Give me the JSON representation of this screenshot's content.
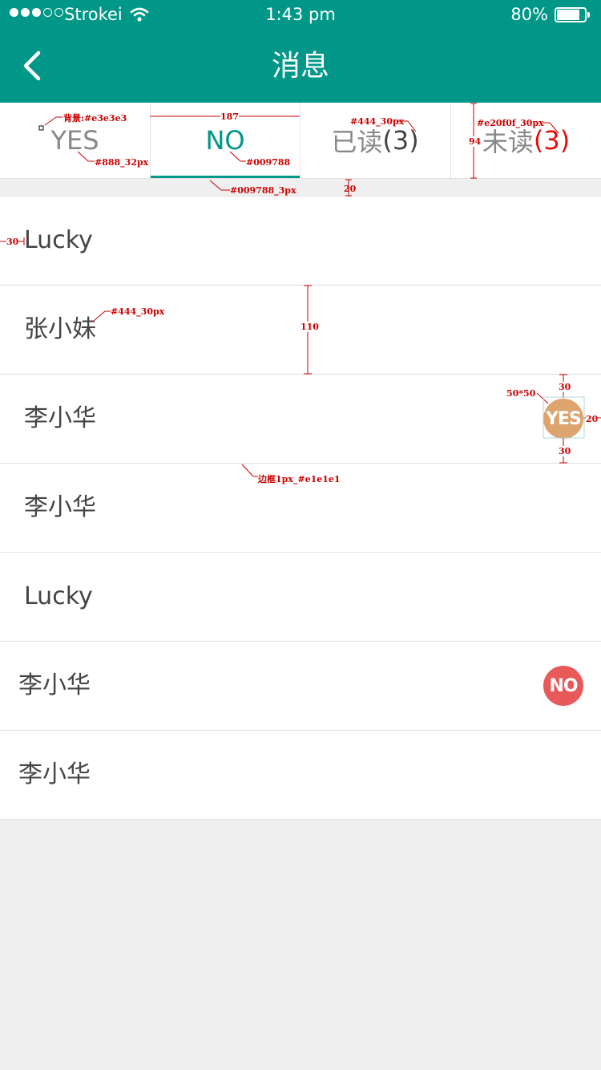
{
  "status_bar": {
    "carrier": "Strokei",
    "time": "1:43 pm",
    "battery": "80%"
  },
  "nav": {
    "title": "消息",
    "back_icon": "chevron-left-icon"
  },
  "tabs": [
    {
      "label": "YES",
      "count": ""
    },
    {
      "label": "NO",
      "count": ""
    },
    {
      "label": "已读",
      "count": "(3)"
    },
    {
      "label": "未读",
      "count": "(3)"
    }
  ],
  "rows": [
    {
      "name": "Lucky",
      "badge": ""
    },
    {
      "name": "张小妹",
      "badge": ""
    },
    {
      "name": "李小华",
      "badge": "YES"
    },
    {
      "name": "李小华",
      "badge": ""
    },
    {
      "name": "Lucky",
      "badge": ""
    },
    {
      "name": "李小华",
      "badge": "NO"
    },
    {
      "name": "李小华",
      "badge": ""
    }
  ],
  "annotations": {
    "bg": "背景:#e3e3e3",
    "tab_text": "#888_32px",
    "active_text": "#009788",
    "active_underline": "#009788_3px",
    "tab_width": "187",
    "read_text": "#444_30px",
    "unread_text": "#e20f0f_30px",
    "tab_height": "94",
    "gap": "20",
    "indent": "30",
    "name_text": "#444_30px",
    "row_height": "110",
    "badge_size": "50*50",
    "badge_top": "30",
    "badge_right": "20",
    "badge_bottom": "30",
    "border": "边框1px_#e1e1e1"
  },
  "colors": {
    "primary": "#009788",
    "background": "#efefef",
    "tab_border": "#e3e3e3",
    "row_border": "#e1e1e1",
    "unread_count": "#e20f0f",
    "badge_yes": "#dda46f",
    "badge_no": "#e85a5a"
  }
}
